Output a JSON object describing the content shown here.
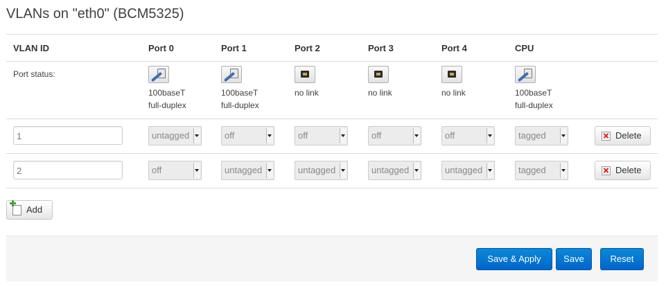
{
  "title": "VLANs on \"eth0\" (BCM5325)",
  "headers": {
    "vlan_id": "VLAN ID",
    "port0": "Port 0",
    "port1": "Port 1",
    "port2": "Port 2",
    "port3": "Port 3",
    "port4": "Port 4",
    "cpu": "CPU"
  },
  "port_status": {
    "label": "Port status:",
    "ports": [
      {
        "icon": "port-connected-icon",
        "line1": "100baseT",
        "line2": "full-duplex"
      },
      {
        "icon": "port-connected-icon",
        "line1": "100baseT",
        "line2": "full-duplex"
      },
      {
        "icon": "port-nolink-icon",
        "line1": "no link",
        "line2": ""
      },
      {
        "icon": "port-nolink-icon",
        "line1": "no link",
        "line2": ""
      },
      {
        "icon": "port-nolink-icon",
        "line1": "no link",
        "line2": ""
      },
      {
        "icon": "port-connected-icon",
        "line1": "100baseT",
        "line2": "full-duplex"
      }
    ]
  },
  "vlans": [
    {
      "id": "1",
      "port0": "untagged",
      "port1": "off",
      "port2": "off",
      "port3": "off",
      "port4": "off",
      "cpu": "tagged",
      "delete_label": "Delete"
    },
    {
      "id": "2",
      "port0": "off",
      "port1": "untagged",
      "port2": "untagged",
      "port3": "untagged",
      "port4": "untagged",
      "cpu": "tagged",
      "delete_label": "Delete"
    }
  ],
  "add_label": "Add",
  "footer": {
    "save_apply_label": "Save & Apply",
    "save_label": "Save",
    "reset_label": "Reset"
  },
  "colors": {
    "primary_button": "#0a7ad1",
    "title_text": "#404040",
    "footer_bg": "#f5f5f5"
  }
}
